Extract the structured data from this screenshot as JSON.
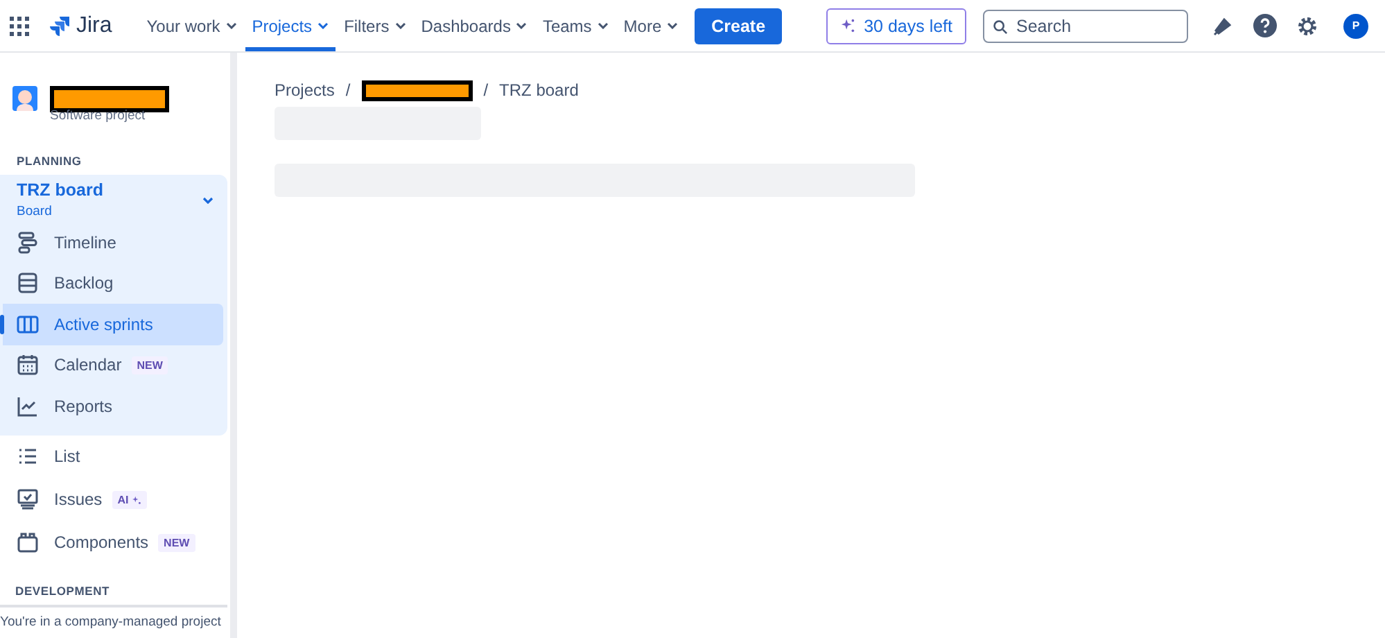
{
  "topbar": {
    "product": "Jira",
    "nav": [
      {
        "label": "Your work",
        "selected": false
      },
      {
        "label": "Projects",
        "selected": true
      },
      {
        "label": "Filters",
        "selected": false
      },
      {
        "label": "Dashboards",
        "selected": false
      },
      {
        "label": "Teams",
        "selected": false
      },
      {
        "label": "More",
        "selected": false
      }
    ],
    "create": "Create",
    "trial": "30 days left",
    "search": {
      "placeholder": "Search"
    },
    "avatar": "P"
  },
  "sidebar": {
    "project_type": "Software project",
    "section": "PLANNING",
    "board": {
      "title": "TRZ board",
      "subtitle": "Board",
      "expanded": true,
      "items": [
        {
          "label": "Timeline",
          "selected": false
        },
        {
          "label": "Backlog",
          "selected": false
        },
        {
          "label": "Active sprints",
          "selected": true
        },
        {
          "label": "Calendar",
          "selected": false,
          "badge": "NEW"
        },
        {
          "label": "Reports",
          "selected": false
        }
      ]
    },
    "items": [
      {
        "label": "List",
        "kind": "plain"
      },
      {
        "label": "Issues",
        "badge": "AI",
        "kind": "ai"
      },
      {
        "label": "Components",
        "badge": "NEW",
        "kind": "new"
      }
    ],
    "section_2": "DEVELOPMENT",
    "footer": "You're in a company-managed project"
  },
  "breadcrumbs": [
    {
      "kind": "link",
      "text": "Projects"
    },
    {
      "kind": "separator",
      "text": "/"
    },
    {
      "kind": "redacted"
    },
    {
      "kind": "separator",
      "text": "/"
    },
    {
      "kind": "link",
      "text": "TRZ board"
    }
  ]
}
